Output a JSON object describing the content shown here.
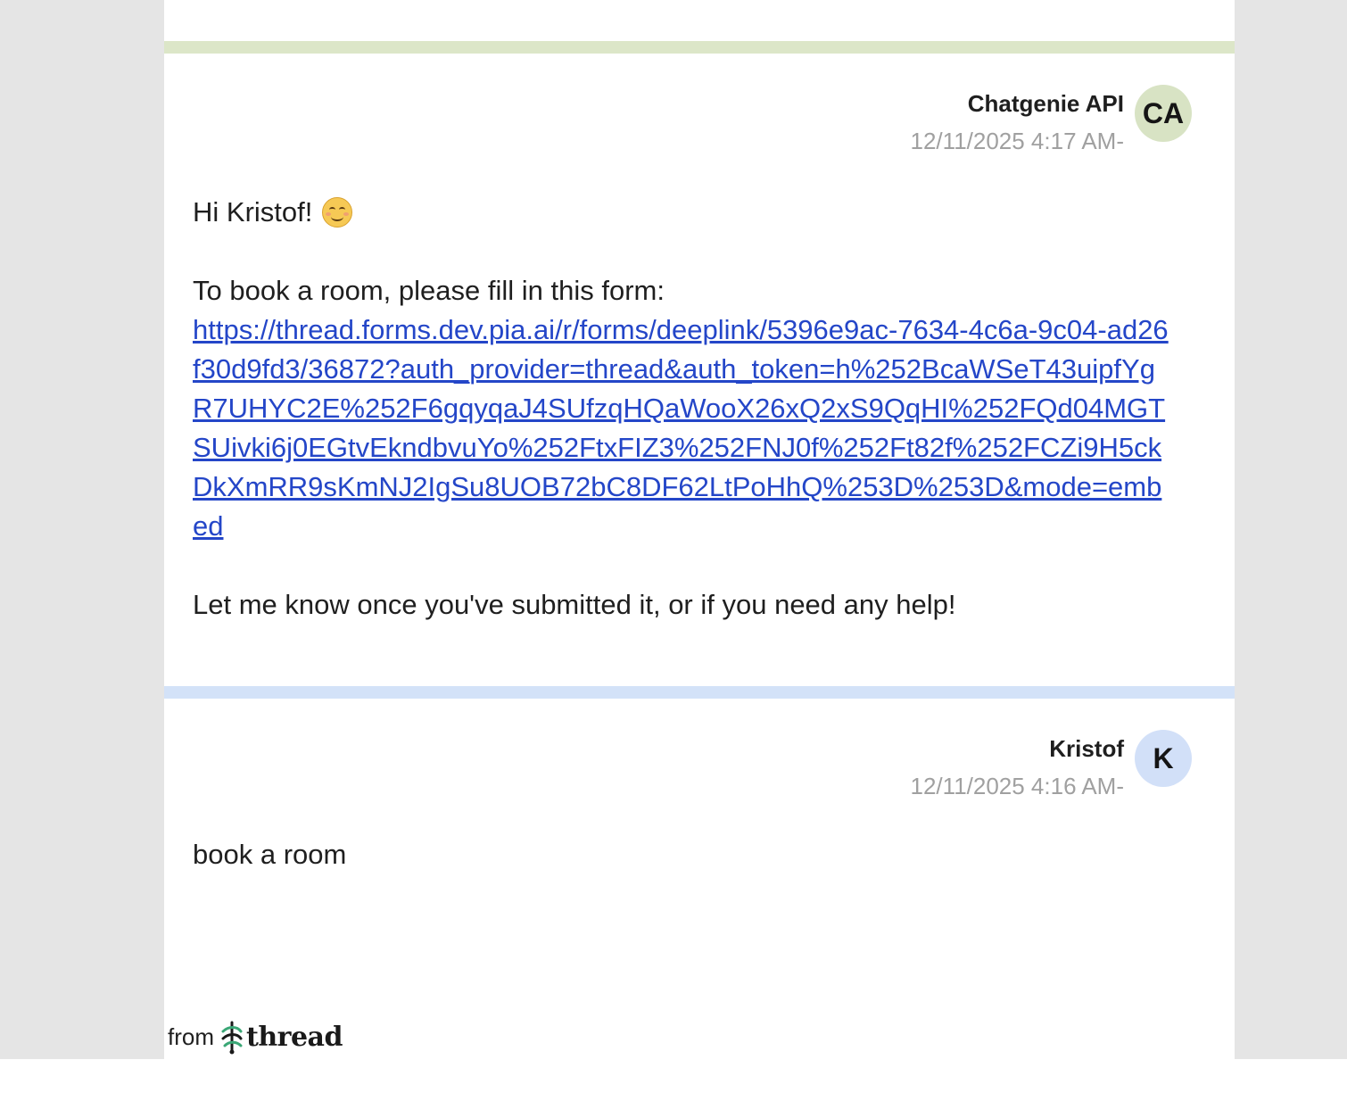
{
  "messages": [
    {
      "sender": "Chatgenie API",
      "initials": "CA",
      "timestamp": "12/11/2025 4:17 AM-",
      "greeting": "Hi Kristof!",
      "intro": "To book a room, please fill in this form:",
      "link_text": "https://thread.forms.dev.pia.ai/r/forms/deeplink/5396e9ac-7634-4c6a-9c04-ad26f30d9fd3/36872?auth_provider=thread&auth_token=h%252BcaWSeT43uipfYgR7UHYC2E%252F6gqyqaJ4SUfzqHQaWooX26xQ2xS9QqHI%252FQd04MGTSUivki6j0EGtvEkndbvuYo%252FtxFIZ3%252FNJ0f%252Ft82f%252FCZi9H5ckDkXmRR9sKmNJ2IgSu8UOB72bC8DF62LtPoHhQ%253D%253D&mode=embed",
      "closing": "Let me know once you've submitted it, or if you need any help!",
      "accent_color": "#dce6c8"
    },
    {
      "sender": "Kristof",
      "initials": "K",
      "timestamp": "12/11/2025 4:16 AM-",
      "body": "book a room",
      "accent_color": "#d3e2f8"
    }
  ],
  "footer": {
    "from_label": "from",
    "brand": "thread"
  },
  "colors": {
    "link": "#2446c8",
    "timestamp": "#a0a0a0",
    "background": "#e5e5e5"
  }
}
